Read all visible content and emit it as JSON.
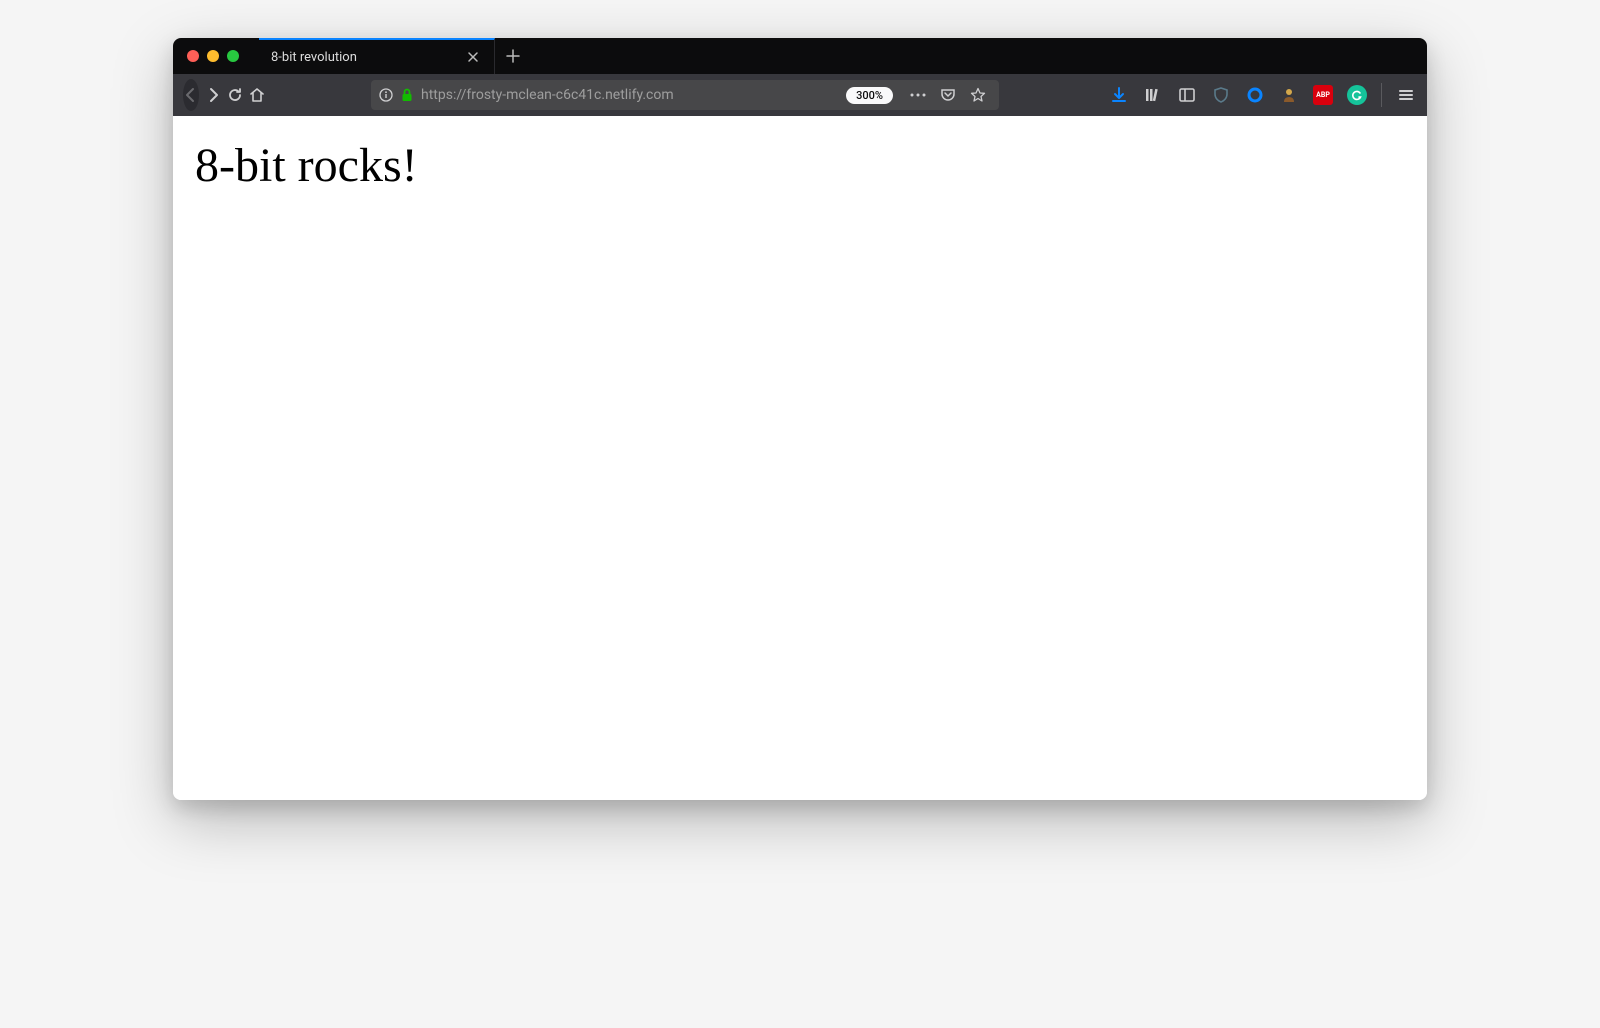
{
  "window": {
    "traffic_lights": [
      "red",
      "yellow",
      "green"
    ]
  },
  "tabs": [
    {
      "title": "8-bit revolution",
      "active": true
    }
  ],
  "navigation": {
    "back_enabled": false,
    "forward_enabled": true
  },
  "address_bar": {
    "protocol": "https://",
    "host_path": "frosty-mclean-c6c41c.netlify.com",
    "zoom_label": "300%",
    "secure": true
  },
  "toolbar_icons": {
    "download": "download-icon",
    "library": "library-icon",
    "sidebar": "sidebar-icon",
    "shield": "shield-icon",
    "circle": "circle-icon",
    "ext1": "extension-icon",
    "abp": "ABP",
    "grammarly": "G",
    "menu": "menu-icon"
  },
  "page": {
    "heading": "8-bit rocks!"
  },
  "colors": {
    "tab_bar": "#0c0c0d",
    "toolbar": "#38383d",
    "address_bg": "#474749",
    "accent_blue": "#0a84ff",
    "lock_green": "#12bc00"
  }
}
